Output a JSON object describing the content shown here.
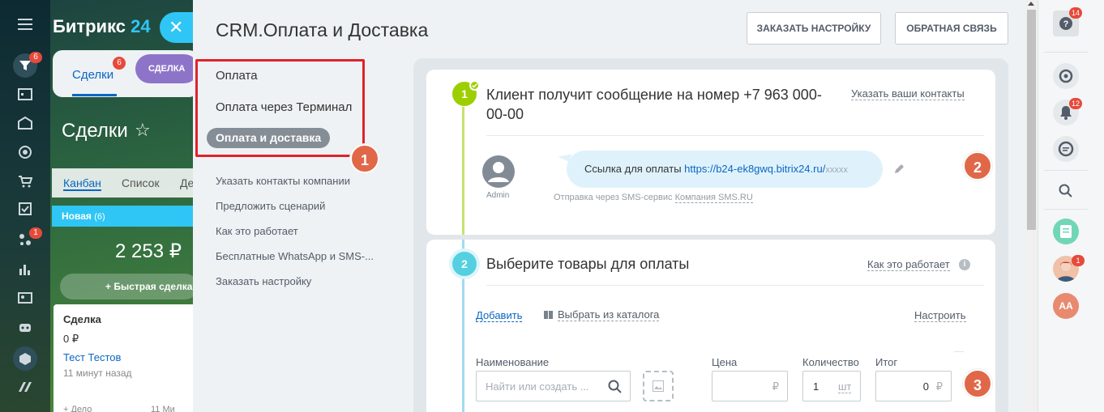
{
  "colors": {
    "accent": "#2fc6f6",
    "link": "#0b66c3",
    "green": "#9dcf00",
    "badge": "#e64a3b",
    "marker": "#e06848"
  },
  "left_rail": {
    "badges": {
      "crm": "6",
      "automation": "1"
    }
  },
  "background_app": {
    "brand_name": "Битрикс",
    "brand_num": "24",
    "close_glyph": "✕",
    "tab_deals": "Сделки",
    "tab_deals_badge": "6",
    "tab_sdelka": "СДЕЛКА",
    "page_title": "Сделки",
    "views": [
      "Канбан",
      "Список",
      "Де"
    ],
    "column": {
      "name": "Новая",
      "count": "(6)",
      "sum": "2 253 ₽"
    },
    "quick_deal": "+ Быстрая сделка",
    "card": {
      "title": "Сделка",
      "price": "0 ₽",
      "contact": "Тест Тестов",
      "time": "11 минут назад",
      "footer_left": "+ Дело",
      "footer_right": "11 Ми"
    }
  },
  "slider": {
    "title": "CRM.Оплата и Доставка",
    "btn_order": "ЗАКАЗАТЬ НАСТРОЙКУ",
    "btn_feedback": "ОБРАТНАЯ СВЯЗЬ",
    "menu": {
      "item1": "Оплата",
      "item2": "Оплата через Терминал",
      "active": "Оплата и доставка",
      "sub": [
        "Указать контакты компании",
        "Предложить сценарий",
        "Как это работает",
        "Бесплатные WhatsApp и SMS-...",
        "Заказать настройку"
      ]
    },
    "markers": [
      "1",
      "2",
      "3"
    ],
    "step1": {
      "num": "1",
      "title_line1": "Клиент получит сообщение на номер +7 963 000-",
      "title_line2": "00-00",
      "link": "Указать ваши контакты",
      "avatar_label": "Admin",
      "bubble_text": "Ссылка для оплаты ",
      "bubble_link": "https://b24-ek8gwq.bitrix24.ru/",
      "bubble_tail": "xxxxx",
      "sms_note": "Отправка через SMS-сервис ",
      "sms_company": "Компания SMS.RU"
    },
    "step2": {
      "num": "2",
      "title": "Выберите товары для оплаты",
      "link": "Как это работает",
      "add": "Добавить",
      "catalog": "Выбрать из каталога",
      "configure": "Настроить",
      "col_name": "Наименование",
      "col_price": "Цена",
      "col_qty": "Количество",
      "col_total": "Итог",
      "search_placeholder": "Найти или создать ...",
      "price_cur": "₽",
      "qty_value": "1",
      "qty_unit": "шт",
      "total_value": "0",
      "total_cur": "₽"
    }
  },
  "right_rail": {
    "help_badge": "14",
    "notif_badge": "12",
    "avatar_badge": "1",
    "initials": "AA"
  }
}
